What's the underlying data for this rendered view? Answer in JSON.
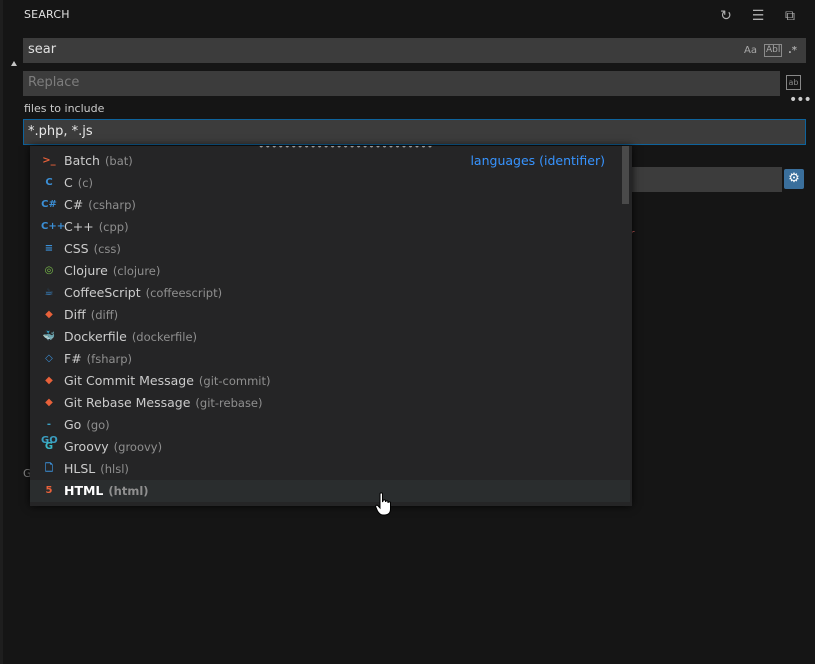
{
  "header": {
    "title": "SEARCH"
  },
  "toolbar": {
    "refresh_icon": "refresh-icon",
    "clear_icon": "clear-results-icon",
    "collapse_icon": "collapse-all-icon"
  },
  "search": {
    "value": "sear",
    "options": [
      "Aa",
      "Abl",
      ".*"
    ]
  },
  "replace": {
    "placeholder": "Replace"
  },
  "include": {
    "label": "files to include",
    "value": "*.php, *.js"
  },
  "suggestions": {
    "items": [
      {
        "name": "Batch",
        "id": "(bat)",
        "icon": "batch-icon",
        "color": "#e8613a",
        "glyph": ">_",
        "detail": "languages (identifier)"
      },
      {
        "name": "C",
        "id": "(c)",
        "icon": "c-icon",
        "color": "#3b8fd6",
        "glyph": "C"
      },
      {
        "name": "C#",
        "id": "(csharp)",
        "icon": "csharp-icon",
        "color": "#3b8fd6",
        "glyph": "C#"
      },
      {
        "name": "C++",
        "id": "(cpp)",
        "icon": "cpp-icon",
        "color": "#3b8fd6",
        "glyph": "C++"
      },
      {
        "name": "CSS",
        "id": "(css)",
        "icon": "css-icon",
        "color": "#3b8fd6",
        "glyph": "≡"
      },
      {
        "name": "Clojure",
        "id": "(clojure)",
        "icon": "clojure-icon",
        "color": "#7cc14c",
        "glyph": "◎"
      },
      {
        "name": "CoffeeScript",
        "id": "(coffeescript)",
        "icon": "coffeescript-icon",
        "color": "#3b8fd6",
        "glyph": "☕"
      },
      {
        "name": "Diff",
        "id": "(diff)",
        "icon": "git-diff-icon",
        "color": "#e8613a",
        "glyph": "◆"
      },
      {
        "name": "Dockerfile",
        "id": "(dockerfile)",
        "icon": "docker-icon",
        "color": "#3b8fd6",
        "glyph": "🐳"
      },
      {
        "name": "F#",
        "id": "(fsharp)",
        "icon": "fsharp-icon",
        "color": "#3b8fd6",
        "glyph": "◇"
      },
      {
        "name": "Git Commit Message",
        "id": "(git-commit)",
        "icon": "git-icon",
        "color": "#e8613a",
        "glyph": "◆"
      },
      {
        "name": "Git Rebase Message",
        "id": "(git-rebase)",
        "icon": "git-icon",
        "color": "#e8613a",
        "glyph": "◆"
      },
      {
        "name": "Go",
        "id": "(go)",
        "icon": "go-icon",
        "color": "#3b9fc2",
        "glyph": "-GO"
      },
      {
        "name": "Groovy",
        "id": "(groovy)",
        "icon": "groovy-icon",
        "color": "#3bb8c7",
        "glyph": "G"
      },
      {
        "name": "HLSL",
        "id": "(hlsl)",
        "icon": "file-icon",
        "color": "#3b8fd6",
        "glyph": "🗋"
      },
      {
        "name": "HTML",
        "id": "(html)",
        "icon": "html5-icon",
        "color": "#e8613a",
        "glyph": "5",
        "selected": true
      }
    ]
  }
}
